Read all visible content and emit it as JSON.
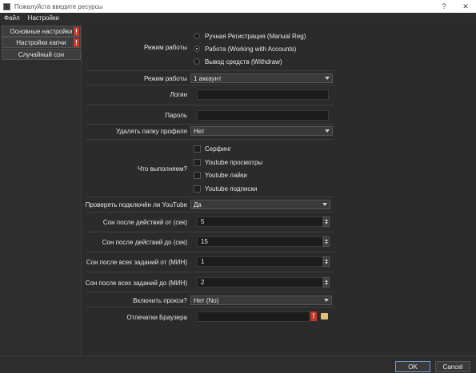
{
  "window": {
    "title": "Пожалуйста введите ресурсы",
    "help": "?",
    "close": "✕"
  },
  "menu": [
    "Файл",
    "Настройки"
  ],
  "sidebar": {
    "items": [
      {
        "label": "Основные настройки",
        "warn": "!"
      },
      {
        "label": "Настройки капчи",
        "warn": "!"
      },
      {
        "label": "Случайный сон"
      }
    ]
  },
  "form": {
    "work_mode": {
      "label": "Режим работы",
      "options": [
        "Ручная Регистрация (Manual Reg)",
        "Работа (Working with Accounts)",
        "Вывод средств (Withdraw)"
      ],
      "selected_index": 1
    },
    "work_mode2": {
      "label": "Режим работы",
      "value": "1 аккаунт"
    },
    "login": {
      "label": "Логин",
      "value": ""
    },
    "password": {
      "label": "Пароль",
      "value": ""
    },
    "delete_profile": {
      "label": "Удалять папку профиля",
      "value": "Нет"
    },
    "what_to_do": {
      "label": "Что выполняем?",
      "options": [
        "Серфинг",
        "Youtube просмотры",
        "Youtube лайки",
        "Youtube подписки"
      ]
    },
    "check_youtube": {
      "label": "Проверять подключён ли YouTube",
      "value": "Да"
    },
    "sleep_after_from": {
      "label": "Сон после действий от (сек)",
      "value": "5"
    },
    "sleep_after_to": {
      "label": "Сон после действий до (сек)",
      "value": "15"
    },
    "sleep_all_from": {
      "label": "Сон после всех заданий от (МИН)",
      "value": "1"
    },
    "sleep_all_to": {
      "label": "Сон после всех заданий до (МИН)",
      "value": "2"
    },
    "proxy": {
      "label": "Включить прокси?",
      "value": "Нет (No)"
    },
    "fingerprints": {
      "label": "Отпечатки Браузера",
      "value": "",
      "warn": "!"
    }
  },
  "footer": {
    "ok": "OK",
    "cancel": "Cancel"
  }
}
